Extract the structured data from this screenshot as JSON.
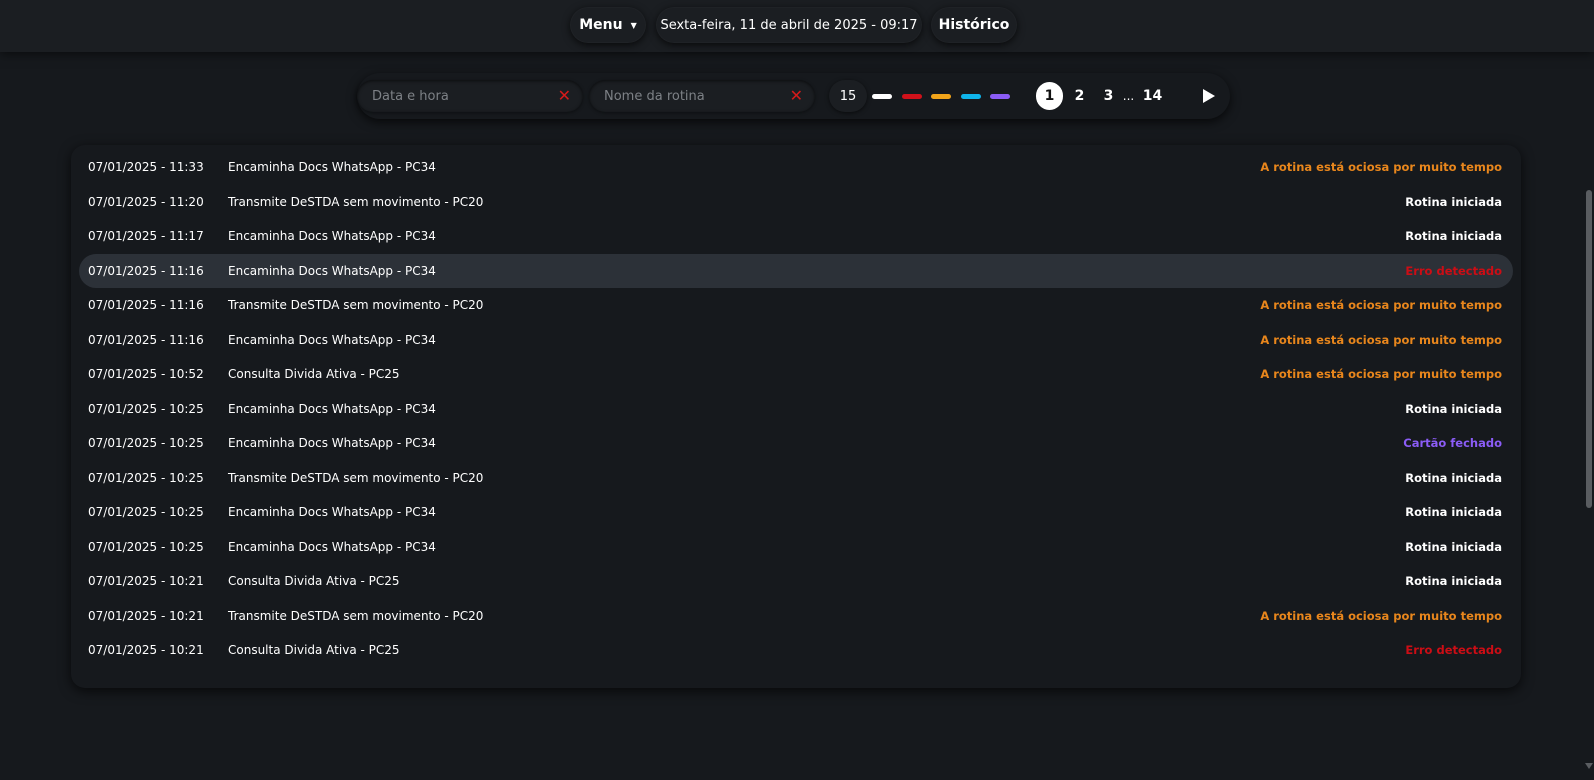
{
  "header": {
    "menu_label": "Menu",
    "date_text": "Sexta-feira, 11 de abril de 2025 - 09:17",
    "history_label": "Histórico"
  },
  "filters": {
    "datetime_placeholder": "Data e hora",
    "routine_placeholder": "Nome da rotina",
    "per_page": "15",
    "status_colors": [
      "#ffffff",
      "#d0111a",
      "#f2a51a",
      "#0fb4ea",
      "#8b5cf6"
    ]
  },
  "pagination": {
    "pages": [
      "1",
      "2",
      "3"
    ],
    "ellipsis": "...",
    "last": "14",
    "current": "1"
  },
  "colors": {
    "white": "#ffffff",
    "orange": "#e8861c",
    "red": "#cc0d15",
    "purple": "#8b5cf6"
  },
  "rows": [
    {
      "datetime": "07/01/2025 - 11:33",
      "routine": "Encaminha Docs WhatsApp - PC34",
      "status": "A rotina está ociosa por muito tempo",
      "status_color": "#e8861c"
    },
    {
      "datetime": "07/01/2025 - 11:20",
      "routine": "Transmite DeSTDA sem movimento - PC20",
      "status": "Rotina iniciada",
      "status_color": "#ffffff"
    },
    {
      "datetime": "07/01/2025 - 11:17",
      "routine": "Encaminha Docs WhatsApp - PC34",
      "status": "Rotina iniciada",
      "status_color": "#ffffff"
    },
    {
      "datetime": "07/01/2025 - 11:16",
      "routine": "Encaminha Docs WhatsApp - PC34",
      "status": "Erro detectado",
      "status_color": "#cc0d15"
    },
    {
      "datetime": "07/01/2025 - 11:16",
      "routine": "Transmite DeSTDA sem movimento - PC20",
      "status": "A rotina está ociosa por muito tempo",
      "status_color": "#e8861c"
    },
    {
      "datetime": "07/01/2025 - 11:16",
      "routine": "Encaminha Docs WhatsApp - PC34",
      "status": "A rotina está ociosa por muito tempo",
      "status_color": "#e8861c"
    },
    {
      "datetime": "07/01/2025 - 10:52",
      "routine": "Consulta Divida Ativa - PC25",
      "status": "A rotina está ociosa por muito tempo",
      "status_color": "#e8861c"
    },
    {
      "datetime": "07/01/2025 - 10:25",
      "routine": "Encaminha Docs WhatsApp - PC34",
      "status": "Rotina iniciada",
      "status_color": "#ffffff"
    },
    {
      "datetime": "07/01/2025 - 10:25",
      "routine": "Encaminha Docs WhatsApp - PC34",
      "status": "Cartão fechado",
      "status_color": "#8b5cf6"
    },
    {
      "datetime": "07/01/2025 - 10:25",
      "routine": "Transmite DeSTDA sem movimento - PC20",
      "status": "Rotina iniciada",
      "status_color": "#ffffff"
    },
    {
      "datetime": "07/01/2025 - 10:25",
      "routine": "Encaminha Docs WhatsApp - PC34",
      "status": "Rotina iniciada",
      "status_color": "#ffffff"
    },
    {
      "datetime": "07/01/2025 - 10:25",
      "routine": "Encaminha Docs WhatsApp - PC34",
      "status": "Rotina iniciada",
      "status_color": "#ffffff"
    },
    {
      "datetime": "07/01/2025 - 10:21",
      "routine": "Consulta Divida Ativa - PC25",
      "status": "Rotina iniciada",
      "status_color": "#ffffff"
    },
    {
      "datetime": "07/01/2025 - 10:21",
      "routine": "Transmite DeSTDA sem movimento - PC20",
      "status": "A rotina está ociosa por muito tempo",
      "status_color": "#e8861c"
    },
    {
      "datetime": "07/01/2025 - 10:21",
      "routine": "Consulta Divida Ativa - PC25",
      "status": "Erro detectado",
      "status_color": "#cc0d15"
    }
  ],
  "highlighted_row": 3
}
